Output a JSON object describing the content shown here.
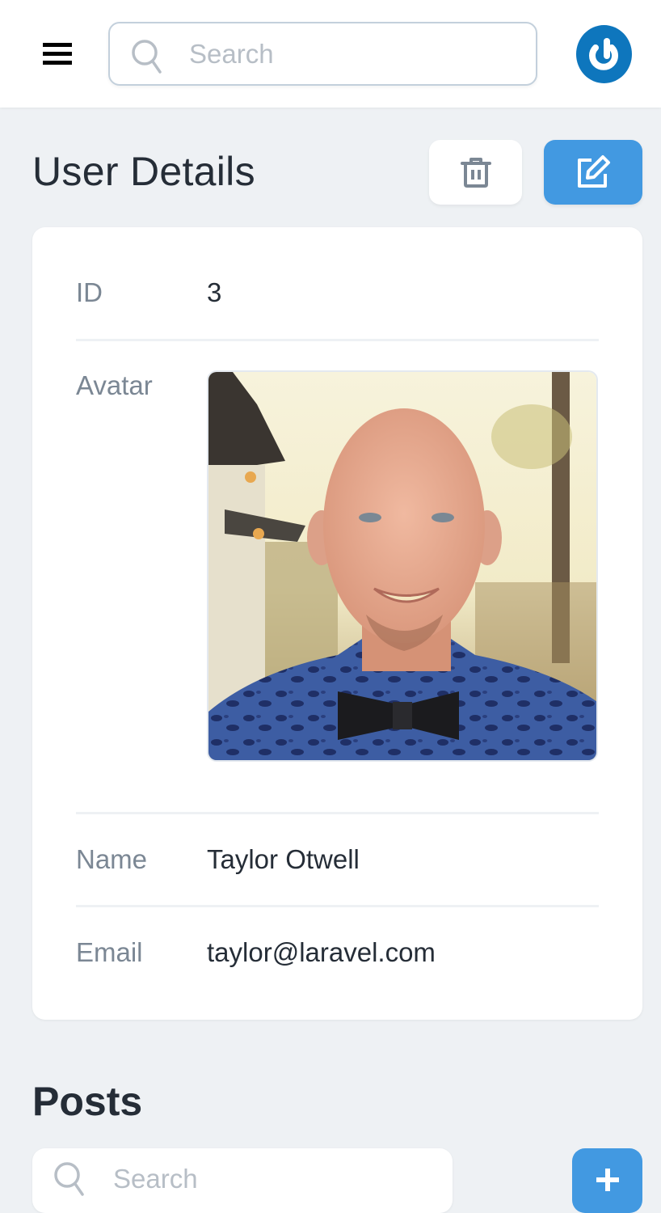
{
  "header": {
    "menu_icon": "hamburger-menu-icon",
    "search": {
      "placeholder": "Search",
      "value": "",
      "icon": "search-icon"
    },
    "logo_icon": "power-logo-icon",
    "colors": {
      "logo": "#0e76bd"
    }
  },
  "page": {
    "title": "User Details",
    "actions": {
      "delete_icon": "trash-icon",
      "edit_icon": "edit-icon"
    },
    "colors": {
      "primary": "#4299e1",
      "background": "#eef1f4"
    }
  },
  "details": {
    "id": {
      "label": "ID",
      "value": "3"
    },
    "avatar": {
      "label": "Avatar",
      "alt": "Taylor Otwell avatar photo"
    },
    "name": {
      "label": "Name",
      "value": "Taylor Otwell"
    },
    "email": {
      "label": "Email",
      "value": "taylor@laravel.com"
    }
  },
  "posts": {
    "title": "Posts",
    "search": {
      "placeholder": "Search",
      "value": ""
    },
    "add_icon": "plus-icon"
  }
}
